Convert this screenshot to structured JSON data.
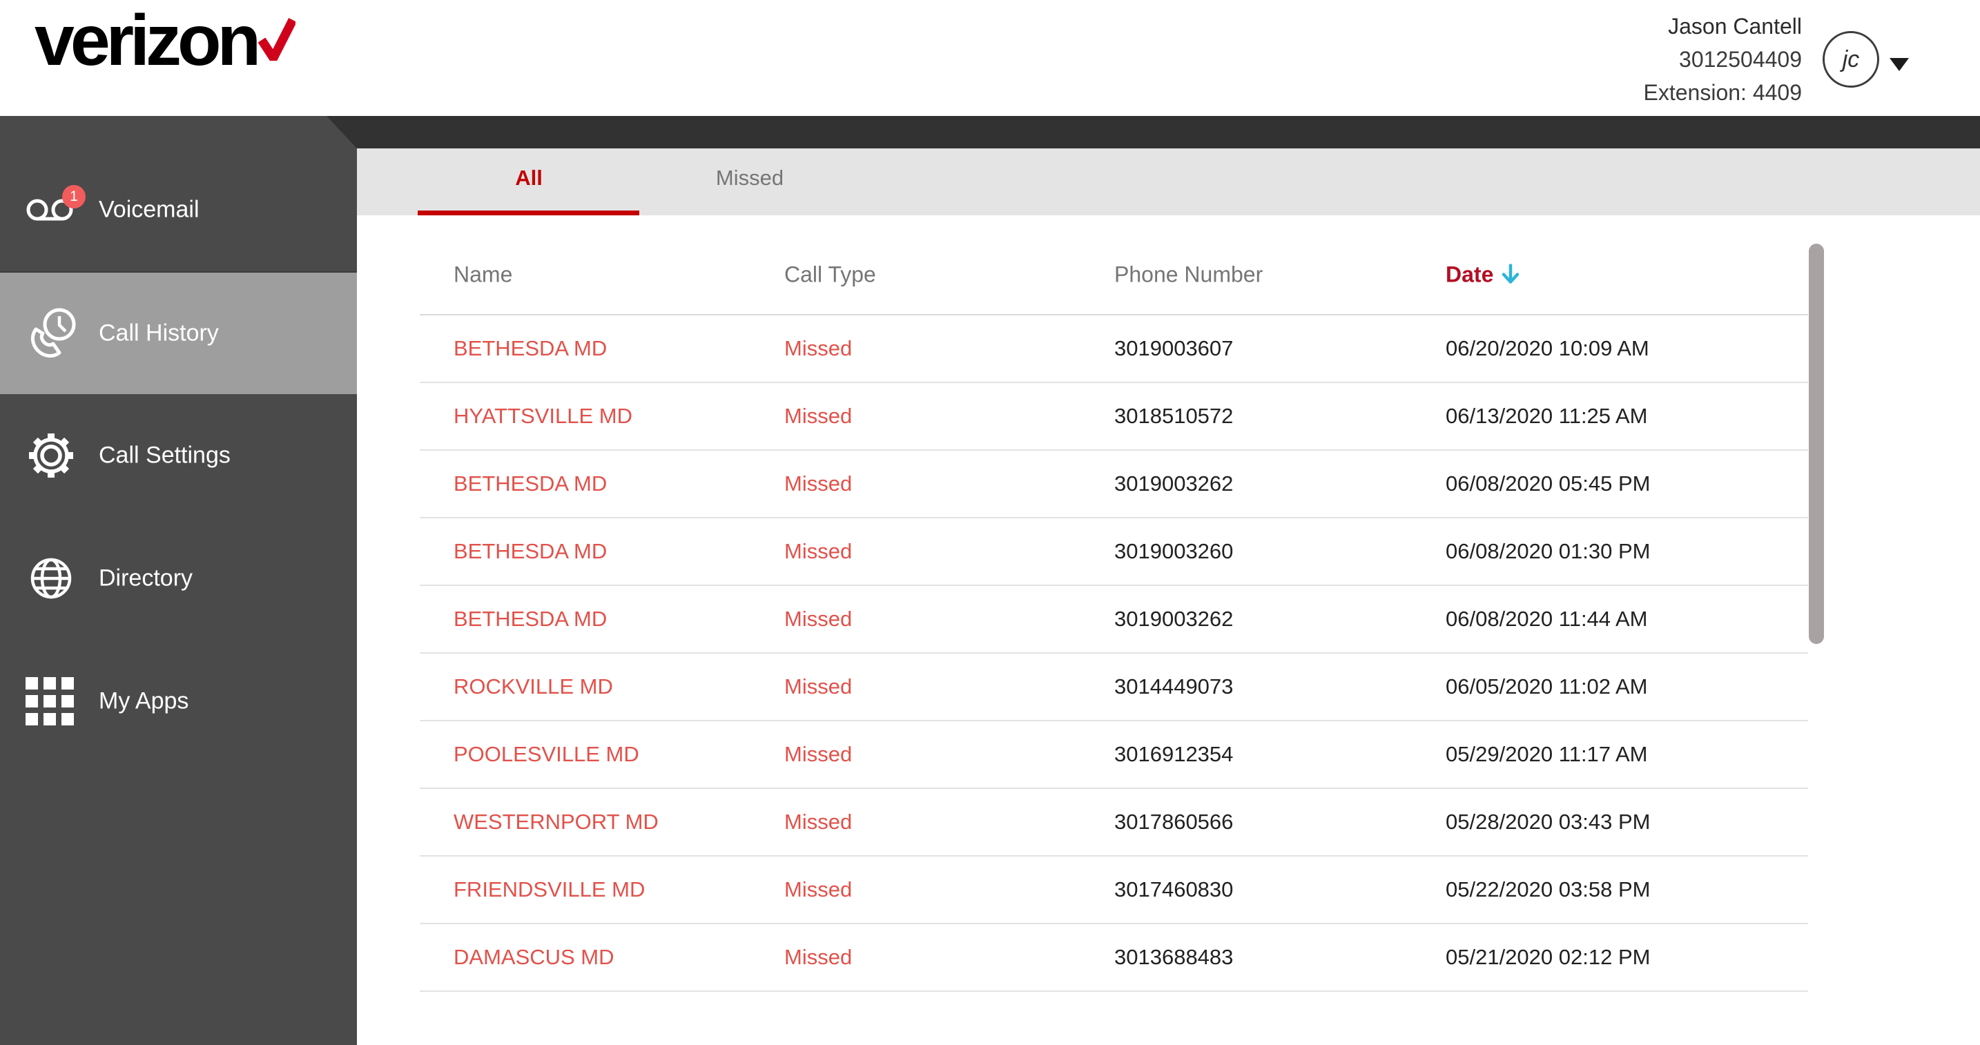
{
  "brand": {
    "logo_text": "verizon"
  },
  "header": {
    "user_name": "Jason Cantell",
    "user_phone": "3012504409",
    "user_extension": "Extension: 4409",
    "avatar_initials": "jc"
  },
  "sidebar": {
    "items": [
      {
        "label": "Voicemail",
        "badge": "1",
        "selected": false
      },
      {
        "label": "Call History",
        "selected": true
      },
      {
        "label": "Call Settings",
        "selected": false
      },
      {
        "label": "Directory",
        "selected": false
      },
      {
        "label": "My Apps",
        "selected": false
      }
    ]
  },
  "tabs": [
    {
      "label": "All",
      "active": true
    },
    {
      "label": "Missed",
      "active": false
    }
  ],
  "table": {
    "columns": [
      "Name",
      "Call Type",
      "Phone Number",
      "Date"
    ],
    "sort": {
      "column": "Date",
      "direction": "desc"
    },
    "rows": [
      {
        "name": "BETHESDA MD",
        "call_type": "Missed",
        "phone": "3019003607",
        "date": "06/20/2020 10:09 AM"
      },
      {
        "name": "HYATTSVILLE MD",
        "call_type": "Missed",
        "phone": "3018510572",
        "date": "06/13/2020 11:25 AM"
      },
      {
        "name": "BETHESDA MD",
        "call_type": "Missed",
        "phone": "3019003262",
        "date": "06/08/2020 05:45 PM"
      },
      {
        "name": "BETHESDA MD",
        "call_type": "Missed",
        "phone": "3019003260",
        "date": "06/08/2020 01:30 PM"
      },
      {
        "name": "BETHESDA MD",
        "call_type": "Missed",
        "phone": "3019003262",
        "date": "06/08/2020 11:44 AM"
      },
      {
        "name": "ROCKVILLE MD",
        "call_type": "Missed",
        "phone": "3014449073",
        "date": "06/05/2020 11:02 AM"
      },
      {
        "name": "POOLESVILLE MD",
        "call_type": "Missed",
        "phone": "3016912354",
        "date": "05/29/2020 11:17 AM"
      },
      {
        "name": "WESTERNPORT MD",
        "call_type": "Missed",
        "phone": "3017860566",
        "date": "05/28/2020 03:43 PM"
      },
      {
        "name": "FRIENDSVILLE MD",
        "call_type": "Missed",
        "phone": "3017460830",
        "date": "05/22/2020 03:58 PM"
      },
      {
        "name": "DAMASCUS MD",
        "call_type": "Missed",
        "phone": "3013688483",
        "date": "05/21/2020 02:12 PM"
      }
    ]
  },
  "colors": {
    "verizon_red": "#d0021b",
    "tab_active_red": "#c40000",
    "date_header_red": "#b40e23",
    "row_link_red": "#e2514a",
    "sort_arrow_cyan": "#2bb5d8",
    "sidebar_bg": "#4a4a4a",
    "sidebar_selected_bg": "#9e9e9e",
    "topbar_bg": "#323232",
    "tabbar_bg": "#e4e4e4",
    "badge_bg": "#f25c5c",
    "column_header_gray": "#757575",
    "cell_text": "#212121",
    "scrollbar": "#a8a2a2"
  }
}
